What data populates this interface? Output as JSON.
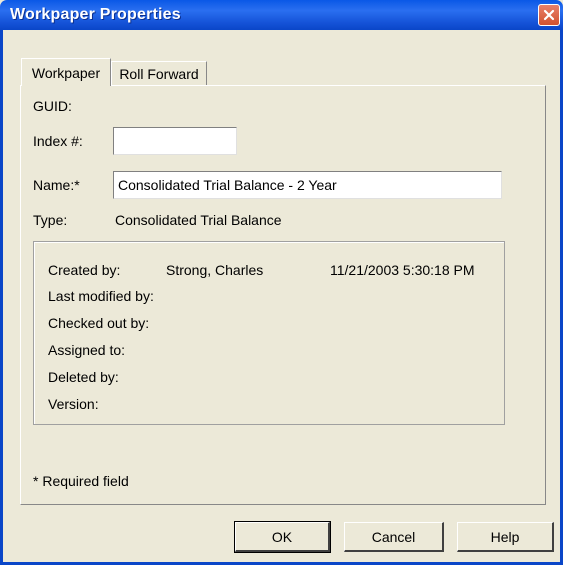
{
  "window": {
    "title": "Workpaper Properties"
  },
  "tabs": [
    {
      "label": "Workpaper",
      "active": true
    },
    {
      "label": "Roll Forward",
      "active": false
    }
  ],
  "form": {
    "guid_label": "GUID:",
    "guid_value": "",
    "index_label": "Index #:",
    "index_value": "",
    "name_label": "Name:*",
    "name_value": "Consolidated Trial Balance - 2 Year",
    "type_label": "Type:",
    "type_value": "Consolidated Trial Balance"
  },
  "details": {
    "created_by_label": "Created by:",
    "created_by_name": "Strong, Charles",
    "created_by_date": "11/21/2003 5:30:18 PM",
    "last_modified_label": "Last modified by:",
    "checked_out_label": "Checked out by:",
    "assigned_to_label": "Assigned to:",
    "deleted_by_label": "Deleted by:",
    "version_label": "Version:"
  },
  "footnote": "* Required field",
  "buttons": {
    "ok": "OK",
    "cancel": "Cancel",
    "help": "Help"
  },
  "colors": {
    "titlebar": "#0a58e6",
    "dialog_bg": "#ece9d8",
    "close_button": "#d2522f"
  }
}
